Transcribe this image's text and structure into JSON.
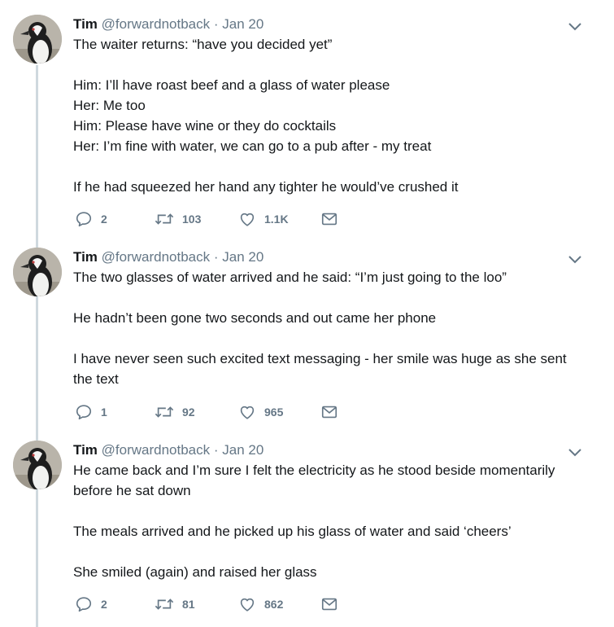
{
  "tweets": [
    {
      "author": "Tim",
      "handle": "@forwardnotback",
      "separator": "·",
      "date": "Jan 20",
      "lines": [
        "The waiter returns: “have you decided yet”",
        "",
        "Him: I’ll have roast beef and a glass of water please",
        "Her: Me too",
        "Him: Please have wine or they do cocktails",
        "Her: I’m fine with water, we can go to a pub after - my treat",
        "",
        "If he had squeezed her hand any tighter he would’ve crushed it"
      ],
      "replies": "2",
      "retweets": "103",
      "likes": "1.1K"
    },
    {
      "author": "Tim",
      "handle": "@forwardnotback",
      "separator": "·",
      "date": "Jan 20",
      "lines": [
        "The two glasses of water arrived and he said: “I’m just going to the loo”",
        "",
        "He hadn’t been gone two seconds and out came her phone",
        "",
        "I have never seen such excited text messaging - her smile was huge as she sent",
        "the text"
      ],
      "replies": "1",
      "retweets": "92",
      "likes": "965"
    },
    {
      "author": "Tim",
      "handle": "@forwardnotback",
      "separator": "·",
      "date": "Jan 20",
      "lines": [
        "He came back and I’m sure I felt the electricity as he stood beside momentarily",
        "before he sat down",
        "",
        "The meals arrived and he picked up his glass of water and said ‘cheers’",
        "",
        "She smiled (again) and raised her glass"
      ],
      "replies": "2",
      "retweets": "81",
      "likes": "862"
    }
  ],
  "icons": {
    "reply": "reply-icon",
    "retweet": "retweet-icon",
    "like": "heart-icon",
    "dm": "envelope-icon",
    "menu": "chevron-down-icon"
  },
  "colors": {
    "text": "#14171a",
    "muted": "#657786",
    "thread_line": "#cfd9de"
  }
}
